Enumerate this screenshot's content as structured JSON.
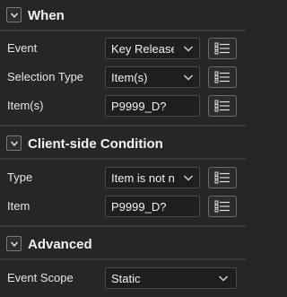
{
  "sections": {
    "when": {
      "title": "When"
    },
    "condition": {
      "title": "Client-side Condition"
    },
    "advanced": {
      "title": "Advanced"
    }
  },
  "when": {
    "event": {
      "label": "Event",
      "value": "Key Release"
    },
    "selection_type": {
      "label": "Selection Type",
      "value": "Item(s)"
    },
    "items": {
      "label": "Item(s)",
      "value": "P9999_D?"
    }
  },
  "condition": {
    "type": {
      "label": "Type",
      "value": "Item is not nu"
    },
    "item": {
      "label": "Item",
      "value": "P9999_D?"
    }
  },
  "advanced": {
    "event_scope": {
      "label": "Event Scope",
      "value": "Static"
    }
  },
  "icons": {
    "collapse": "chevron-down-icon",
    "dropdown": "chevron-down-icon",
    "list": "list-icon"
  }
}
